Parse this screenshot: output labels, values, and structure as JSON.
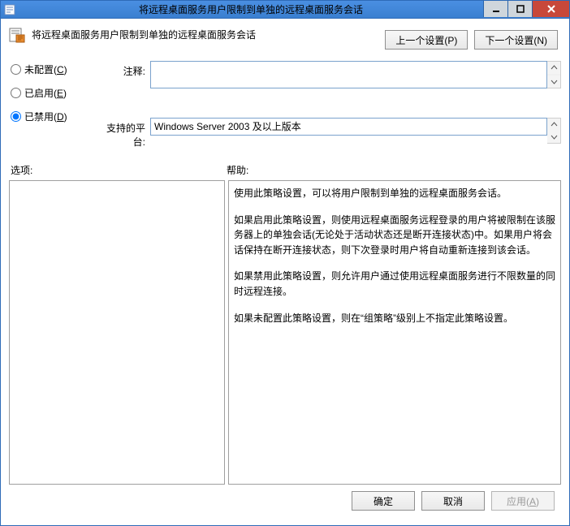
{
  "window": {
    "title": "将远程桌面服务用户限制到单独的远程桌面服务会话"
  },
  "header": {
    "heading": "将远程桌面服务用户限制到单独的远程桌面服务会话",
    "prev_button": "上一个设置(P)",
    "next_button": "下一个设置(N)"
  },
  "config": {
    "not_configured": {
      "label_pre": "未配置(",
      "key": "C",
      "label_post": ")"
    },
    "enabled": {
      "label_pre": "已启用(",
      "key": "E",
      "label_post": ")"
    },
    "disabled": {
      "label_pre": "已禁用(",
      "key": "D",
      "label_post": ")"
    },
    "selected": "disabled",
    "comment_label": "注释:",
    "comment_value": "",
    "platform_label": "支持的平台:",
    "platform_value": "Windows Server 2003 及以上版本"
  },
  "panels": {
    "options_label": "选项:",
    "help_label": "帮助:",
    "help_paragraphs": [
      "使用此策略设置，可以将用户限制到单独的远程桌面服务会话。",
      "如果启用此策略设置，则使用远程桌面服务远程登录的用户将被限制在该服务器上的单独会话(无论处于活动状态还是断开连接状态)中。如果用户将会话保持在断开连接状态，则下次登录时用户将自动重新连接到该会话。",
      "如果禁用此策略设置，则允许用户通过使用远程桌面服务进行不限数量的同时远程连接。",
      "如果未配置此策略设置，则在“组策略”级别上不指定此策略设置。"
    ]
  },
  "buttons": {
    "ok": "确定",
    "cancel": "取消",
    "apply_pre": "应用(",
    "apply_key": "A",
    "apply_post": ")"
  }
}
